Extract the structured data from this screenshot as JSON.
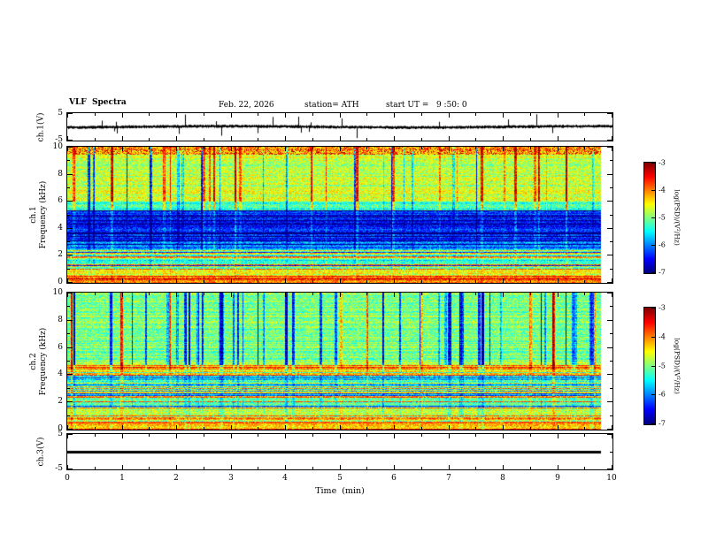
{
  "header": {
    "title": "VLF  Spectra",
    "date": "Feb. 22, 2026",
    "station": "station= ATH",
    "start_ut": "start UT =   9 :50: 0"
  },
  "xaxis": {
    "label": "Time  (min)",
    "ticks": [
      0,
      1,
      2,
      3,
      4,
      5,
      6,
      7,
      8,
      9,
      10
    ]
  },
  "colorbar": {
    "label": "log(PSD)/(V²/Hz)",
    "ticks": [
      -3,
      -4,
      -5,
      -6,
      -7
    ],
    "clim": [
      -7,
      -3
    ],
    "colormap": "jet"
  },
  "chart_data": [
    {
      "type": "line",
      "name": "ch1-waveform",
      "ylabel": "ch.1(V)",
      "ylim": [
        -5,
        5
      ],
      "yticks": [
        5,
        -5
      ],
      "yticks_minor": [
        0
      ],
      "xlim": [
        0,
        10
      ],
      "noise_amp": 0.38,
      "spike_prob": 0.035,
      "spike_amp_max": 4.6,
      "data_end_frac": 1.0,
      "line_color": "#000000",
      "description": "Noisy ch.1 voltage trace fluctuating around 0 V with frequent impulsive spikes up to about ±4.5 V over the 10-minute record"
    },
    {
      "type": "heatmap",
      "name": "ch1-spectrogram",
      "ylabel": [
        "ch.1",
        "Frequency (kHz)"
      ],
      "ylim": [
        0,
        10
      ],
      "yticks": [
        10,
        8,
        6,
        4,
        2,
        0
      ],
      "yticks_minor": [
        9,
        7,
        5,
        3,
        1
      ],
      "xlim": [
        0,
        10
      ],
      "clim": [
        -7,
        -3
      ],
      "colormap": "jet",
      "data_end_frac": 0.98,
      "streaks": {
        "bright_prob": 0.05,
        "dark_prob": 0.07,
        "amp": 1.25,
        "max_len": 3
      },
      "bands": [
        {
          "f0": 9.4,
          "f1": 10,
          "level": -4.3,
          "streak_weight": 0.9,
          "red_speckle": 0.3
        },
        {
          "f0": 6.0,
          "f1": 9.4,
          "level": -4.75,
          "streak_weight": 1.0
        },
        {
          "f0": 5.3,
          "f1": 6.0,
          "level": -5.3,
          "streak_weight": 0.8
        },
        {
          "f0": 3.0,
          "f1": 5.3,
          "level": -6.35,
          "streak_weight": 0.35,
          "stripes": {
            "dark": 0.18,
            "amp": 0.7
          }
        },
        {
          "f0": 2.4,
          "f1": 3.0,
          "level": -5.9,
          "streak_weight": 0.3,
          "stripes": {
            "bright": 0.15,
            "dark": 0.1,
            "amp": 0.7
          }
        },
        {
          "f0": 1.0,
          "f1": 2.4,
          "level": -5.1,
          "streak_weight": 0.2,
          "stripes": {
            "bright": 0.3,
            "dark": 0.08,
            "red": 0.05,
            "amp": 0.8
          }
        },
        {
          "f0": 0.35,
          "f1": 1.0,
          "level": -4.6,
          "streak_weight": 0.15,
          "stripes": {
            "bright": 0.35,
            "red": 0.05,
            "amp": 0.7
          }
        },
        {
          "f0": 0.0,
          "f1": 0.35,
          "level": -4.1,
          "streak_weight": 0.1,
          "stripes": {
            "bright": 0.4,
            "red": 0.08,
            "amp": 0.6
          }
        }
      ],
      "description": "ch.1 VLF spectrogram 0-10 kHz, jet colormap: red speckled band at top, green 6-9.4 kHz with bright/dark vertical streaks, dark blue low-power band 3-5.3 kHz, striped cyan/green below 3 kHz, bright band near 0 kHz"
    },
    {
      "type": "heatmap",
      "name": "ch2-spectrogram",
      "ylabel": [
        "ch.2",
        "Frequency (kHz)"
      ],
      "ylim": [
        0,
        10
      ],
      "yticks": [
        10,
        8,
        6,
        4,
        2,
        0
      ],
      "yticks_minor": [
        9,
        7,
        5,
        3,
        1
      ],
      "xlim": [
        0,
        10
      ],
      "clim": [
        -7,
        -3
      ],
      "colormap": "jet",
      "data_end_frac": 0.98,
      "streaks": {
        "bright_prob": 0.05,
        "dark_prob": 0.12,
        "amp": 1.4,
        "max_len": 3
      },
      "bands": [
        {
          "f0": 4.7,
          "f1": 10,
          "level": -5.0,
          "streak_weight": 1.0
        },
        {
          "f0": 4.3,
          "f1": 4.7,
          "level": -4.6,
          "streak_weight": 0.5,
          "stripes": {
            "bright": 0.5,
            "amp": 0.7
          }
        },
        {
          "f0": 1.6,
          "f1": 4.3,
          "level": -5.25,
          "streak_weight": 0.3,
          "stripes": {
            "bright": 0.22,
            "dark": 0.12,
            "red": 0.06,
            "amp": 0.8
          }
        },
        {
          "f0": 0.6,
          "f1": 1.6,
          "level": -4.8,
          "streak_weight": 0.25,
          "stripes": {
            "bright": 0.3,
            "red": 0.06,
            "amp": 0.7
          }
        },
        {
          "f0": 0.0,
          "f1": 0.6,
          "level": -4.3,
          "streak_weight": 0.2,
          "stripes": {
            "bright": 0.4,
            "red": 0.08,
            "amp": 0.6
          }
        }
      ],
      "description": "ch.2 VLF spectrogram 0-10 kHz, jet colormap: green upper half with many dark blue vertical streaks, yellowish band near 4.5 kHz, densely horizontally striped cyan/green/yellow/red region below 4 kHz, bright band near 0 kHz"
    },
    {
      "type": "line",
      "name": "ch3-waveform",
      "ylabel": "ch.3(V)",
      "ylim": [
        -5,
        5
      ],
      "yticks": [
        5,
        -5
      ],
      "yticks_minor": [
        0
      ],
      "xlim": [
        0,
        10
      ],
      "flat_value": 0,
      "line_width": 3,
      "data_end_frac": 0.98,
      "line_color": "#000000",
      "description": "ch.3 voltage is flat at 0 V for the whole record, drawn as a thick black horizontal line"
    }
  ]
}
